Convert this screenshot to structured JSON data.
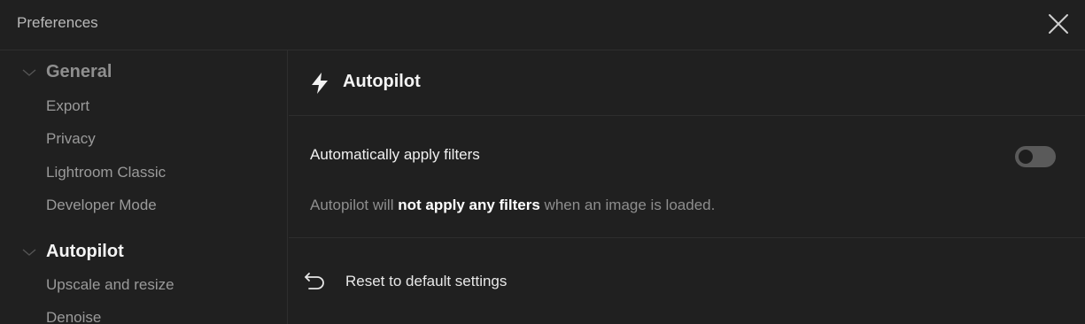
{
  "window": {
    "title": "Preferences",
    "close_icon": "close-icon"
  },
  "sidebar": {
    "groups": [
      {
        "label": "General",
        "expanded": true,
        "active": false,
        "items": [
          "Export",
          "Privacy",
          "Lightroom Classic",
          "Developer Mode"
        ]
      },
      {
        "label": "Autopilot",
        "expanded": true,
        "active": true,
        "items": [
          "Upscale and resize",
          "Denoise"
        ]
      }
    ]
  },
  "main": {
    "section_icon": "lightning-bolt-icon",
    "section_title": "Autopilot",
    "setting": {
      "label": "Automatically apply filters",
      "enabled": false
    },
    "description": {
      "prefix": "Autopilot will ",
      "emphasis": "not apply any filters",
      "suffix": " when an image is loaded."
    },
    "reset": {
      "icon": "undo-arrow-icon",
      "label": "Reset to default settings"
    }
  },
  "colors": {
    "background": "#202020",
    "divider": "#2e2e2e",
    "toggle_off": "#5a5a5a"
  }
}
